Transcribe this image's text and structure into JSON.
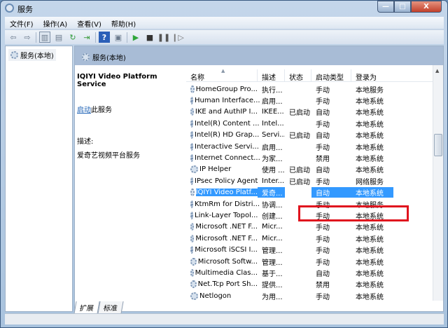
{
  "window": {
    "title": "服务",
    "min": "—",
    "max": "□",
    "close": "X"
  },
  "menu": [
    "文件(F)",
    "操作(A)",
    "查看(V)",
    "帮助(H)"
  ],
  "toolbar": {
    "icons": [
      "back-icon",
      "forward-icon",
      "show-tree-icon",
      "properties-icon",
      "refresh-icon",
      "export-icon",
      "help-icon",
      "console-icon",
      "start-icon",
      "stop-icon",
      "pause-icon",
      "restart-icon"
    ]
  },
  "tree": {
    "root": "服务(本地)"
  },
  "header": {
    "title": "服务(本地)"
  },
  "details": {
    "service_name": "IQIYI Video Platform Service",
    "start_link": "启动",
    "start_suffix": "此服务",
    "desc_label": "描述:",
    "desc_text": "爱奇艺视频平台服务"
  },
  "columns": [
    "名称",
    "描述",
    "状态",
    "启动类型",
    "登录为"
  ],
  "rows": [
    [
      "HomeGroup Pro...",
      "执行...",
      "",
      "手动",
      "本地服务"
    ],
    [
      "Human Interface...",
      "启用...",
      "",
      "手动",
      "本地系统"
    ],
    [
      "IKE and AuthIP I...",
      "IKEE...",
      "已启动",
      "自动",
      "本地系统"
    ],
    [
      "Intel(R) Content ...",
      "Intel...",
      "",
      "手动",
      "本地系统"
    ],
    [
      "Intel(R) HD Grap...",
      "Servi...",
      "已启动",
      "自动",
      "本地系统"
    ],
    [
      "Interactive Servi...",
      "启用...",
      "",
      "手动",
      "本地系统"
    ],
    [
      "Internet Connect...",
      "为家...",
      "",
      "禁用",
      "本地系统"
    ],
    [
      "IP Helper",
      "使用 ...",
      "已启动",
      "自动",
      "本地系统"
    ],
    [
      "IPsec Policy Agent",
      "Inter...",
      "已启动",
      "手动",
      "网络服务"
    ],
    [
      "IQIYI Video Platf...",
      "爱奇...",
      "",
      "自动",
      "本地系统"
    ],
    [
      "KtmRm for Distri...",
      "协调...",
      "",
      "手动",
      "本地服务"
    ],
    [
      "Link-Layer Topol...",
      "创建...",
      "",
      "手动",
      "本地系统"
    ],
    [
      "Microsoft .NET F...",
      "Micr...",
      "",
      "手动",
      "本地系统"
    ],
    [
      "Microsoft .NET F...",
      "Micr...",
      "",
      "手动",
      "本地系统"
    ],
    [
      "Microsoft iSCSI I...",
      "管理...",
      "",
      "手动",
      "本地系统"
    ],
    [
      "Microsoft Softw...",
      "管理...",
      "",
      "手动",
      "本地系统"
    ],
    [
      "Multimedia Clas...",
      "基于...",
      "",
      "自动",
      "本地系统"
    ],
    [
      "Net.Tcp Port Sh...",
      "提供...",
      "",
      "禁用",
      "本地系统"
    ],
    [
      "Netlogon",
      "为用...",
      "",
      "手动",
      "本地系统"
    ]
  ],
  "selected_index": 9,
  "tabs": [
    "扩展",
    "标准"
  ],
  "colors": {
    "selection": "#3399ff",
    "highlight_box": "#e0141e"
  }
}
